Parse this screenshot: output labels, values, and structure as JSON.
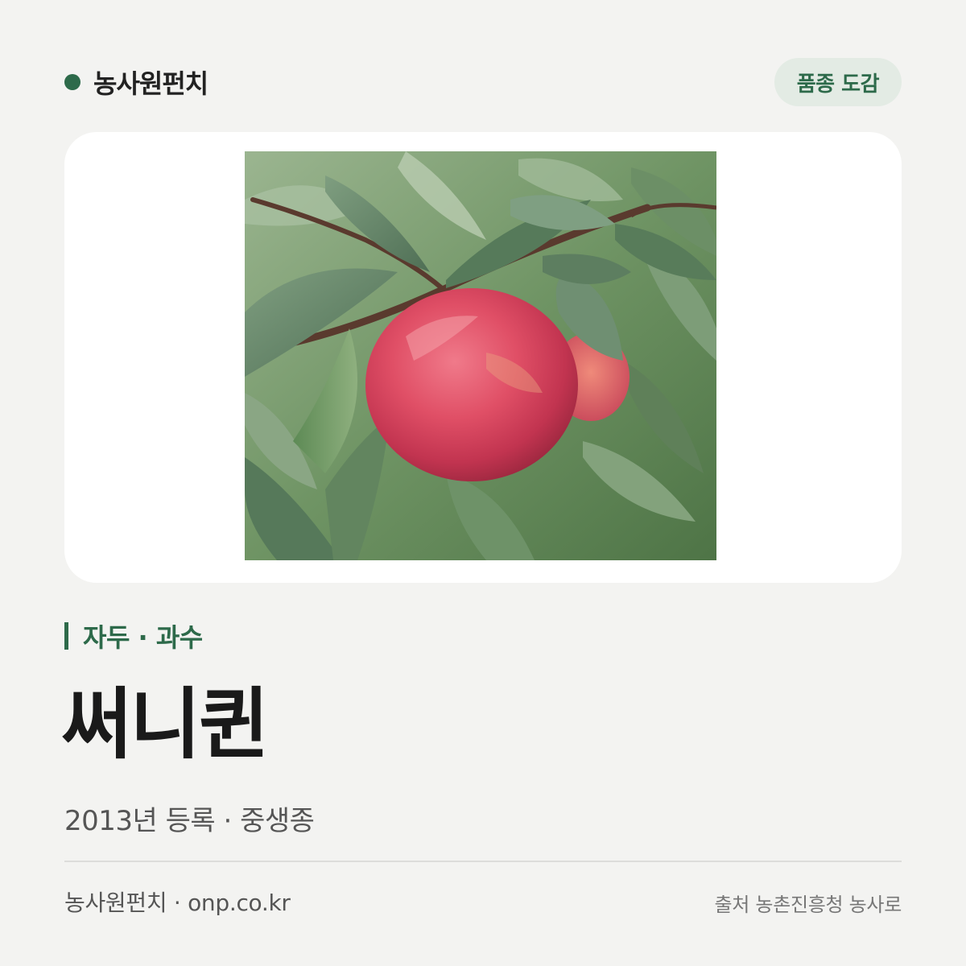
{
  "header": {
    "brand_name": "농사원펀치",
    "badge_label": "품종 도감"
  },
  "image": {
    "alt": "써니퀸",
    "accent_colors": {
      "leaf": "#4f7a4a",
      "fruit": "#d9485a",
      "branch": "#5a3a2e"
    }
  },
  "variety": {
    "category": "자두 · 과수",
    "name": "써니퀸",
    "subtitle": "2013년 등록 · 중생종"
  },
  "footer": {
    "left": "농사원펀치 · onp.co.kr",
    "right": "출처 농촌진흥청 농사로"
  },
  "colors": {
    "accent": "#2d6a4a",
    "badge_bg": "#e3ebe4",
    "page_bg": "#f3f3f1"
  }
}
